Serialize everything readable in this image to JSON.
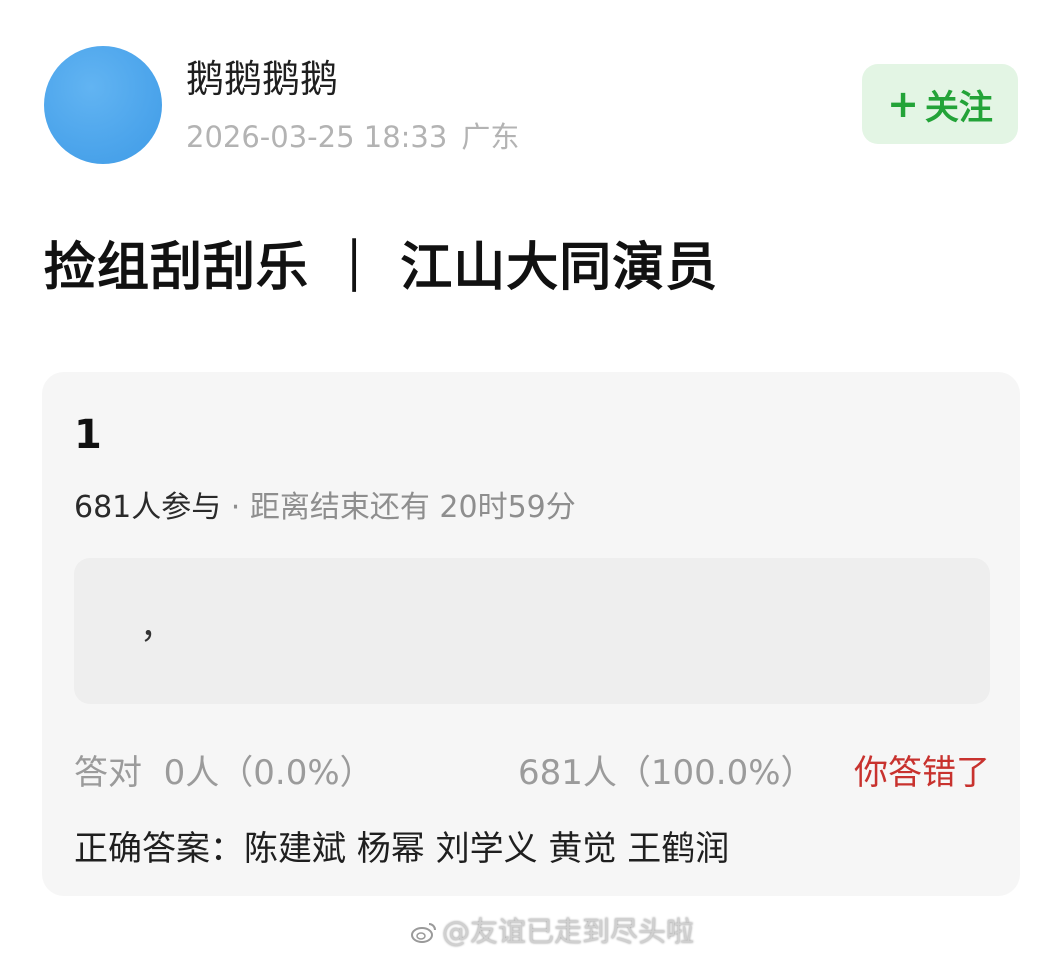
{
  "header": {
    "username": "鹅鹅鹅鹅",
    "date": "2026-03-25 18:33",
    "location": "广东",
    "follow_label": "关注",
    "follow_icon": "plus-icon",
    "avatar_color": "#4ea6ec",
    "follow_color": "#23a338"
  },
  "post": {
    "title": "捡组刮刮乐 ｜ 江山大同演员"
  },
  "quiz": {
    "number": "1",
    "participants": "681人参与",
    "separator": " · ",
    "time_left": "距离结束还有 20时59分",
    "answer": "，",
    "correct_label": "答对",
    "correct_stat": "0人（0.0%）",
    "wrong_stat": "681人（100.0%）",
    "wrong_status": "你答错了",
    "wrong_color": "#c8322e",
    "correct_answer_label": "正确答案：",
    "correct_answer_value": "陈建斌 杨幂 刘学义 黄觉 王鹤润"
  },
  "watermark": {
    "icon": "weibo-icon",
    "text": "@友谊已走到尽头啦"
  }
}
